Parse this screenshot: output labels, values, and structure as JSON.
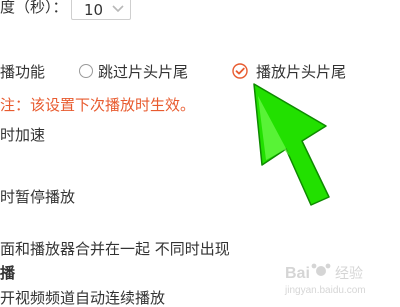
{
  "speed_row": {
    "label": "度（秒）：",
    "value": "10"
  },
  "skip_row": {
    "label": "播功能",
    "option_skip": "跳过片头片尾",
    "option_play": "播放片头片尾"
  },
  "note": "注：该设置下次播放时生效。",
  "items": {
    "accel": "时加速",
    "pause": "时暂停播放",
    "merge": "面和播放器合并在一起 不同时出现",
    "section": "播",
    "autoplay": "开视频频道自动连续播放"
  },
  "colors": {
    "accent": "#e85b2f",
    "arrow": "#22e000"
  },
  "watermark": "Bai 经验 jingyan.baidu.com"
}
